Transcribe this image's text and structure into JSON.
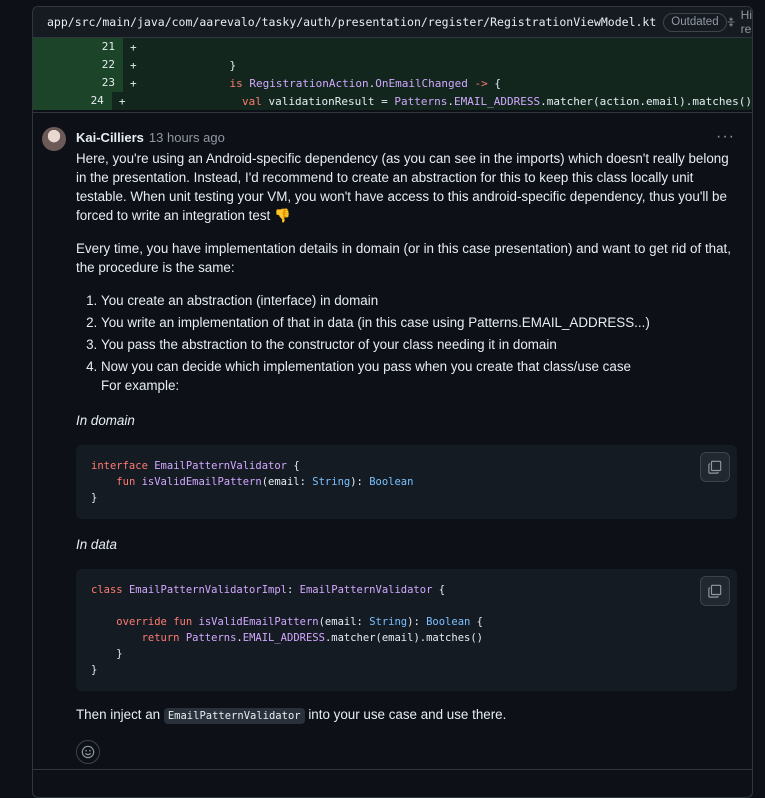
{
  "file": {
    "path": "app/src/main/java/com/aarevalo/tasky/auth/presentation/register/RegistrationViewModel.kt",
    "badge": "Outdated",
    "hide_resolved": "Hide resolved"
  },
  "diff": {
    "lines": [
      {
        "num": "21",
        "sign": "+",
        "code": ""
      },
      {
        "num": "22",
        "sign": "+",
        "code": "            }"
      },
      {
        "num": "23",
        "sign": "+",
        "code": "            is RegistrationAction.OnEmailChanged -> {"
      },
      {
        "num": "24",
        "sign": "+",
        "code": "                val validationResult = Patterns.EMAIL_ADDRESS.matcher(action.email).matches()"
      }
    ]
  },
  "comment": {
    "author": "Kai-Cilliers",
    "time": "13 hours ago",
    "more": "···",
    "p1": "Here, you're using an Android-specific dependency (as you can see in the imports) which doesn't really belong in the presentation. Instead, I'd recommend to create an abstraction for this to keep this class locally unit testable. When unit testing your VM, you won't have access to this android-specific dependency, thus you'll be forced to write an integration test 👎",
    "p2": "Every time, you have implementation details in domain (or in this case presentation) and want to get rid of that, the procedure is the same:",
    "steps": [
      "You create an abstraction (interface) in domain",
      "You write an implementation of that in data (in this case using Patterns.EMAIL_ADDRESS...)",
      "You pass the abstraction to the constructor of your class needing it in domain",
      "Now you can decide which implementation you pass when you create that class/use case"
    ],
    "for_example": "For example:",
    "in_domain": "In domain",
    "in_data": "In data",
    "code_domain": {
      "kw_interface": "interface",
      "name": "EmailPatternValidator",
      "brace_open": " {",
      "kw_fun": "fun",
      "fn_name": "isValidEmailPattern",
      "param": "(email: ",
      "type_string": "String",
      "ret": "): ",
      "type_boolean": "Boolean",
      "brace_close": "}"
    },
    "code_data": {
      "kw_class": "class",
      "name": "EmailPatternValidatorImpl",
      "colon": ": ",
      "iface": "EmailPatternValidator",
      "brace_open": " {",
      "kw_override": "override",
      "kw_fun": "fun",
      "fn_name": "isValidEmailPattern",
      "param": "(email: ",
      "type_string": "String",
      "ret": "): ",
      "type_boolean": "Boolean",
      "kw_return": "return",
      "patterns": "Patterns",
      "email_addr": "EMAIL_ADDRESS",
      "rest": ".matcher(email).matches()",
      "inner_close": "}",
      "brace_close": "}"
    },
    "closing_pre": "Then inject an ",
    "closing_code": "EmailPatternValidator",
    "closing_post": " into your use case and use there."
  },
  "colors": {
    "keyword": "#ff7b72",
    "function": "#d2a8ff",
    "type": "#79c0ff",
    "diff_bg": "#12261e"
  },
  "icons": [
    "fold-icon",
    "copy-icon",
    "smiley-icon",
    "avatar"
  ]
}
